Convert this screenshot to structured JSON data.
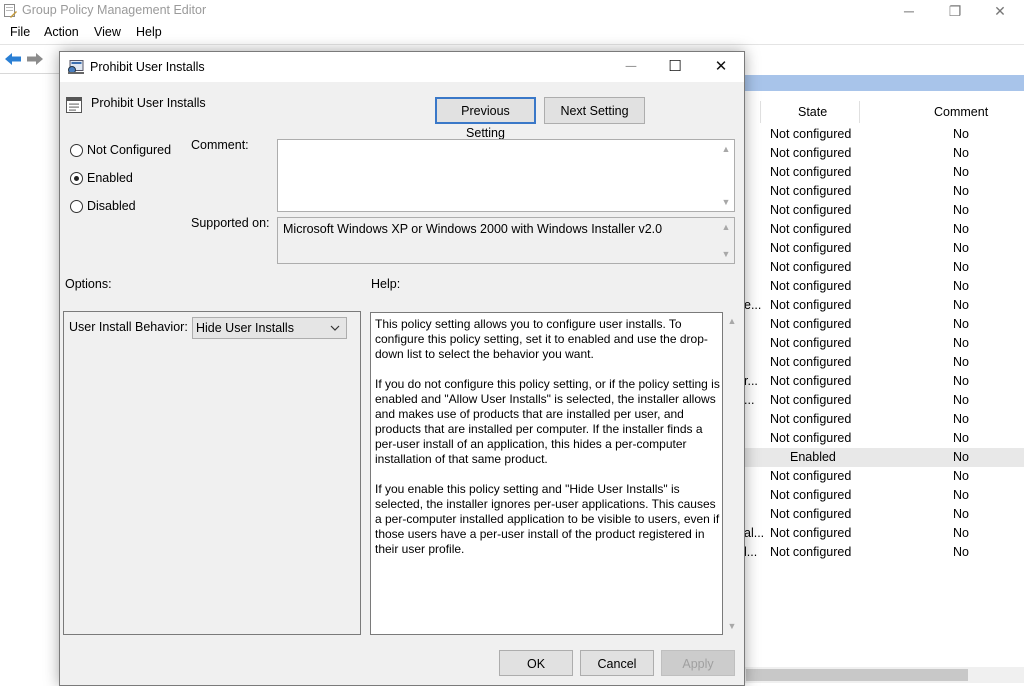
{
  "main_window": {
    "title": "Group Policy Management Editor",
    "controls": {
      "minimize": "─",
      "maximize": "❐",
      "close": "✕"
    },
    "menu": [
      "File",
      "Action",
      "View",
      "Help"
    ],
    "columns": {
      "state": "State",
      "comment": "Comment"
    },
    "rows": [
      {
        "prefix": "",
        "state": "Not configured",
        "comment": "No",
        "selected": false
      },
      {
        "prefix": "",
        "state": "Not configured",
        "comment": "No",
        "selected": false
      },
      {
        "prefix": "",
        "state": "Not configured",
        "comment": "No",
        "selected": false
      },
      {
        "prefix": "",
        "state": "Not configured",
        "comment": "No",
        "selected": false
      },
      {
        "prefix": "",
        "state": "Not configured",
        "comment": "No",
        "selected": false
      },
      {
        "prefix": "",
        "state": "Not configured",
        "comment": "No",
        "selected": false
      },
      {
        "prefix": "",
        "state": "Not configured",
        "comment": "No",
        "selected": false
      },
      {
        "prefix": "",
        "state": "Not configured",
        "comment": "No",
        "selected": false
      },
      {
        "prefix": "",
        "state": "Not configured",
        "comment": "No",
        "selected": false
      },
      {
        "prefix": "e...",
        "state": "Not configured",
        "comment": "No",
        "selected": false
      },
      {
        "prefix": "",
        "state": "Not configured",
        "comment": "No",
        "selected": false
      },
      {
        "prefix": "",
        "state": "Not configured",
        "comment": "No",
        "selected": false
      },
      {
        "prefix": "",
        "state": "Not configured",
        "comment": "No",
        "selected": false
      },
      {
        "prefix": "r...",
        "state": "Not configured",
        "comment": "No",
        "selected": false
      },
      {
        "prefix": "...",
        "state": "Not configured",
        "comment": "No",
        "selected": false
      },
      {
        "prefix": "",
        "state": "Not configured",
        "comment": "No",
        "selected": false
      },
      {
        "prefix": "",
        "state": "Not configured",
        "comment": "No",
        "selected": false
      },
      {
        "prefix": "",
        "state": "Enabled",
        "comment": "No",
        "selected": true
      },
      {
        "prefix": "",
        "state": "Not configured",
        "comment": "No",
        "selected": false
      },
      {
        "prefix": "",
        "state": "Not configured",
        "comment": "No",
        "selected": false
      },
      {
        "prefix": "",
        "state": "Not configured",
        "comment": "No",
        "selected": false
      },
      {
        "prefix": "al...",
        "state": "Not configured",
        "comment": "No",
        "selected": false
      },
      {
        "prefix": "l...",
        "state": "Not configured",
        "comment": "No",
        "selected": false
      }
    ]
  },
  "dialog": {
    "title": "Prohibit User Installs",
    "controls": {
      "minimize": "─",
      "maximize": "☐",
      "close": "✕"
    },
    "policy_name": "Prohibit User Installs",
    "previous_setting": "Previous Setting",
    "next_setting": "Next Setting",
    "radios": [
      {
        "label": "Not Configured",
        "checked": false
      },
      {
        "label": "Enabled",
        "checked": true
      },
      {
        "label": "Disabled",
        "checked": false
      }
    ],
    "comment_label": "Comment:",
    "comment_value": "",
    "supported_label": "Supported on:",
    "supported_value": "Microsoft Windows XP or Windows 2000 with Windows Installer v2.0",
    "options_label": "Options:",
    "help_label": "Help:",
    "option_user_install_label": "User Install Behavior:",
    "option_user_install_value": "Hide User Installs",
    "help_paragraphs": [
      "This policy setting allows you to configure user installs. To configure this policy setting, set it to enabled and use the drop-down list to select the behavior you want.",
      "If you do not configure this policy setting, or if the policy setting is enabled and \"Allow User Installs\" is selected, the installer allows and makes use of products that are installed per user, and products that are installed per computer. If the installer finds a per-user install of an application, this hides a per-computer installation of that same product.",
      "If you enable this policy setting and \"Hide User Installs\" is selected, the installer ignores per-user applications. This causes a per-computer installed application to be visible to users, even if those users have a per-user install of the product registered in their user profile."
    ],
    "ok": "OK",
    "cancel": "Cancel",
    "apply": "Apply"
  },
  "colors": {
    "accent": "#3a78c8",
    "list_header_bar": "#a8c4ea",
    "selected_row": "#e8e8e8"
  },
  "icons": [
    "app-icon",
    "back-arrow-icon",
    "forward-arrow-icon",
    "policy-icon",
    "chevron-down-icon",
    "scroll-up-icon",
    "scroll-down-icon"
  ]
}
